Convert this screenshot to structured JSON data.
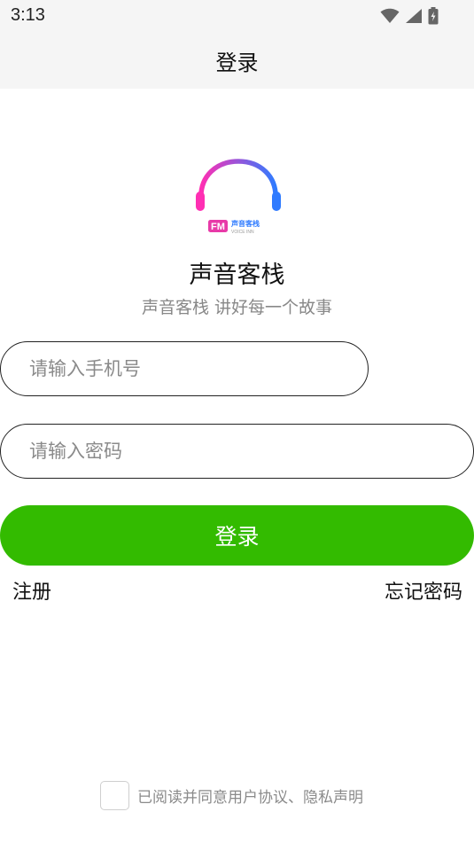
{
  "status_bar": {
    "time": "3:13",
    "icons": [
      "wifi-icon",
      "cellular-signal-icon",
      "battery-charging-icon"
    ]
  },
  "header": {
    "title": "登录"
  },
  "logo": {
    "badge_text": "FM",
    "brand_text": "声音客栈",
    "brand_subtext": "VOICE INN",
    "colors": {
      "gradient_start": "#ff2fb3",
      "gradient_end": "#2f7bff",
      "badge": "#e83aa8"
    }
  },
  "app": {
    "name": "声音客栈",
    "slogan": "声音客栈 讲好每一个故事"
  },
  "form": {
    "phone": {
      "placeholder": "请输入手机号",
      "value": ""
    },
    "password": {
      "placeholder": "请输入密码",
      "value": ""
    },
    "login_label": "登录",
    "register_label": "注册",
    "forgot_label": "忘记密码"
  },
  "agreement": {
    "checked": false,
    "text": "已阅读并同意用户协议、隐私声明"
  },
  "colors": {
    "primary_button": "#33bb00",
    "bar_background": "#f5f5f5",
    "placeholder": "#8a8a8a"
  }
}
